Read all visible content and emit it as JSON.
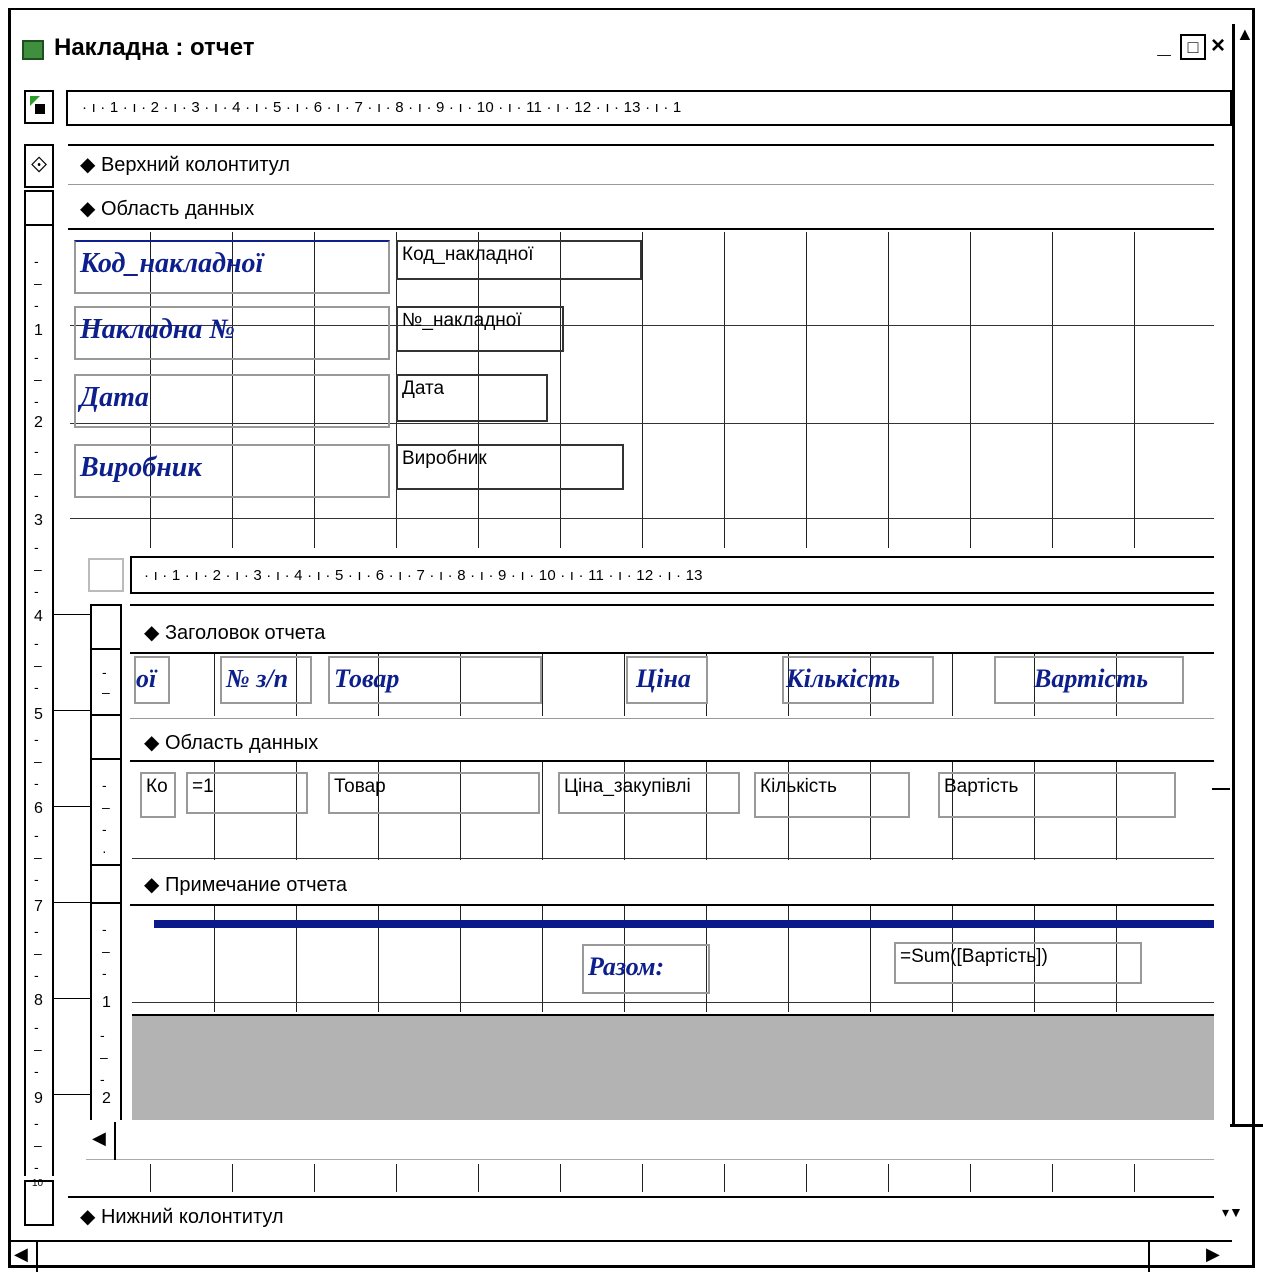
{
  "window": {
    "title": "Накладна : отчет",
    "minimize": "_",
    "maximize": "□",
    "close": "×"
  },
  "main_ruler": {
    "ticks": "· ı · 1 · ı · 2 · ı · 3 · ı · 4 · ı · 5 · ı · 6 · ı · 7 · ı · 8 · ı · 9 · ı · 10 · ı · 11 · ı · 12 · ı · 13 · ı · 1"
  },
  "sub_ruler": {
    "ticks": "· ı · 1 · ı · 2 · ı · 3 · ı · 4 · ı · 5 · ı · 6 · ı · 7 · ı · 8 · ı · 9 · ı · 10 · ı · 11 · ı · 12 · ı · 13"
  },
  "vertical_ruler": {
    "labels": [
      "1",
      "2",
      "3",
      "4",
      "5",
      "6",
      "7",
      "8",
      "9",
      "10"
    ]
  },
  "sub_vertical_ruler": {
    "labels": [
      "1",
      "2"
    ]
  },
  "sections": {
    "page_header": "Верхний колонтитул",
    "detail": "Область данных",
    "page_footer": "Нижний колонтитул"
  },
  "detail_labels": [
    "Код_накладної",
    "Накладна №",
    "Дата",
    "Виробник"
  ],
  "detail_fields": [
    "Код_накладної",
    "№_накладної",
    "Дата",
    "Виробник"
  ],
  "subreport": {
    "report_header": "Заголовок отчета",
    "detail": "Область данных",
    "report_footer": "Примечание отчета",
    "header_labels": [
      "ої",
      "№ з/п",
      "Товар",
      "Ціна",
      "Кількість",
      "Вартість"
    ],
    "detail_fields": [
      "Ко",
      "=1",
      "Товар",
      "Ціна_закупівлі",
      "Кількість",
      "Вартість"
    ],
    "total_label": "Разом:",
    "total_field": "=Sum([Вартість])"
  },
  "colors": {
    "label_blue": "#0d1f8c",
    "footer_line": "#0a1a8a",
    "gray_area": "#b3b3b3"
  }
}
